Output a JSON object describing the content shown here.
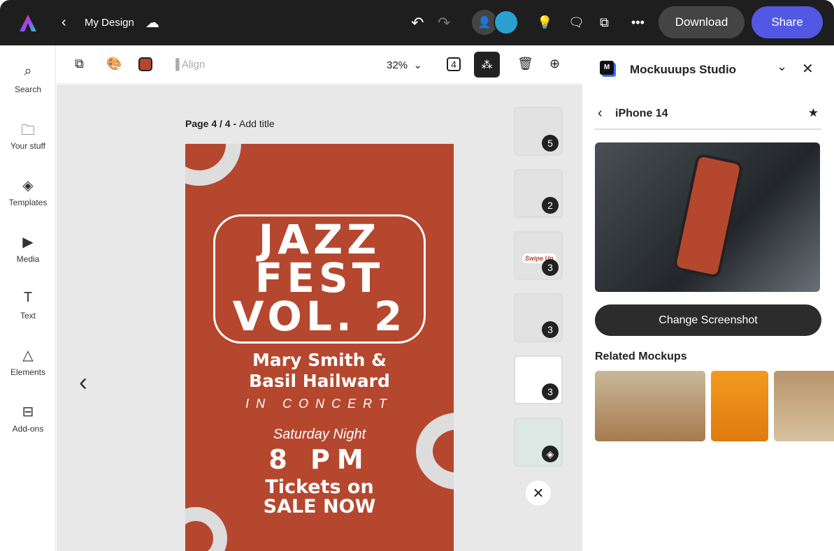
{
  "header": {
    "title": "My Design",
    "download": "Download",
    "share": "Share",
    "accent": "#5258e4"
  },
  "sidebar": {
    "items": [
      {
        "label": "Search",
        "icon": "search-icon"
      },
      {
        "label": "Your stuff",
        "icon": "folder-icon"
      },
      {
        "label": "Templates",
        "icon": "templates-icon"
      },
      {
        "label": "Media",
        "icon": "media-icon"
      },
      {
        "label": "Text",
        "icon": "text-icon"
      },
      {
        "label": "Elements",
        "icon": "elements-icon"
      },
      {
        "label": "Add-ons",
        "icon": "addons-icon"
      }
    ]
  },
  "toolbar": {
    "align": "Align",
    "zoom": "32%",
    "page_count_icon": "4",
    "fill_color": "#b5472f"
  },
  "canvas": {
    "page_label": "Page 4 / 4 - ",
    "add_title": "Add title"
  },
  "poster": {
    "line1": "JAZZ",
    "line2": "FEST",
    "line3": "VOL. 2",
    "names1": "Mary Smith &",
    "names2": "Basil Hailward",
    "concert": "IN CONCERT",
    "day": "Saturday Night",
    "time": "8 PM",
    "tickets1": "Tickets on",
    "tickets2": "SALE NOW"
  },
  "thumbnails": [
    {
      "badge": "5"
    },
    {
      "badge": "2"
    },
    {
      "badge": "3",
      "text": "Swipe Up"
    },
    {
      "badge": "3"
    },
    {
      "badge": "3"
    },
    {
      "badge": "layers-icon"
    }
  ],
  "panel": {
    "title": "Mockuuups Studio",
    "back_title": "iPhone 14",
    "change": "Change Screenshot",
    "related": "Related Mockups"
  }
}
